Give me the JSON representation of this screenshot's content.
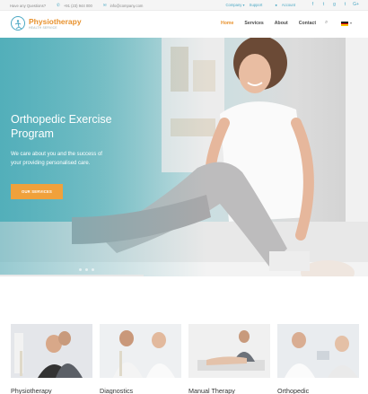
{
  "topbar": {
    "question": "Have any Questions?",
    "phone_icon": "phone-icon",
    "phone": "+91 (23) 944 000",
    "email_icon": "mail-icon",
    "email": "info@company.com",
    "company": "Company",
    "support": "Support",
    "user_icon": "user-icon",
    "account": "Account",
    "social": [
      "f",
      "t",
      "g",
      "t",
      "G+"
    ]
  },
  "header": {
    "logo_title": "Physiotherapy",
    "logo_subtitle": "HEALTH SERVICE",
    "nav": [
      "Home",
      "Services",
      "About",
      "Contact"
    ],
    "search_icon": "search-icon"
  },
  "hero": {
    "title": "Orthopedic Exercise Program",
    "text": "We care about you and the success of your providing personalised care.",
    "button": "OUR SERVICES"
  },
  "cards": [
    {
      "title": "Physiotherapy"
    },
    {
      "title": "Diagnostics"
    },
    {
      "title": "Manual Therapy"
    },
    {
      "title": "Orthopedic"
    }
  ],
  "colors": {
    "accent": "#e8922e",
    "brand_teal": "#4ba8c4",
    "button": "#f0a13b"
  }
}
